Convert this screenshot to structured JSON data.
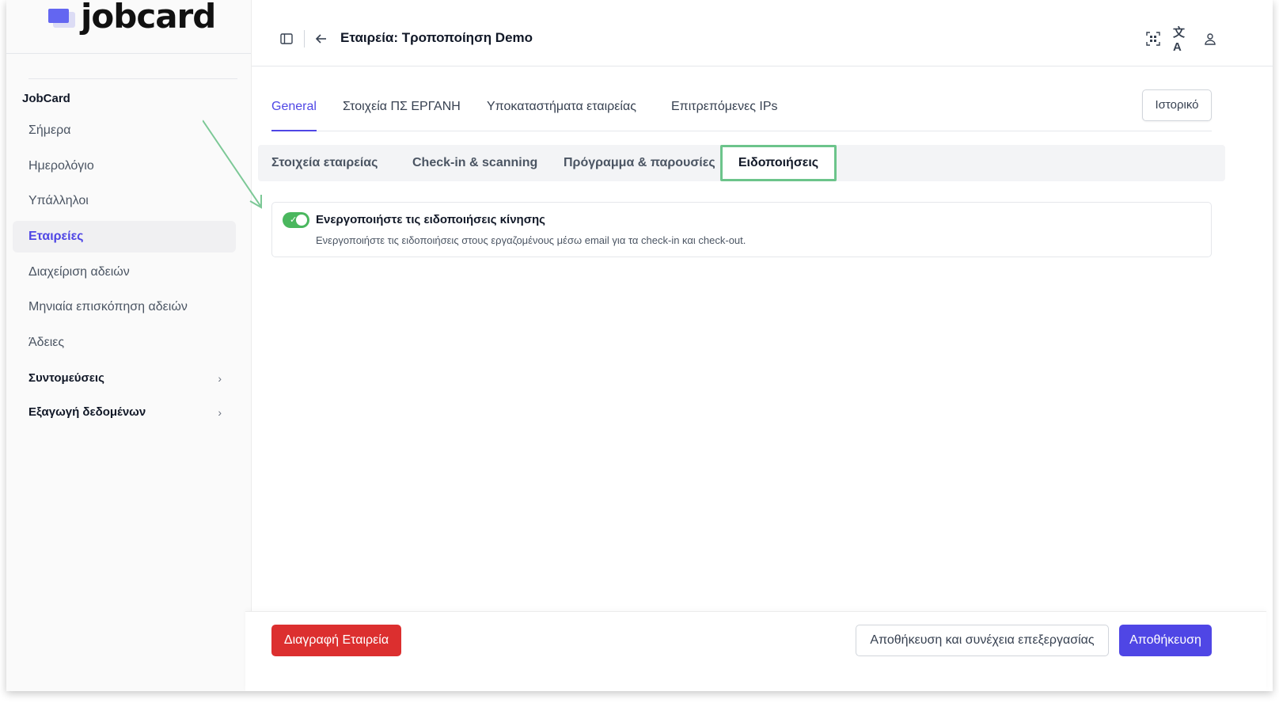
{
  "brand": {
    "name": "jobcard",
    "accent": "#4f46e5"
  },
  "sidebar": {
    "section_title": "JobCard",
    "items": [
      {
        "label": "Σήμερα",
        "active": false
      },
      {
        "label": "Ημερολόγιο",
        "active": false
      },
      {
        "label": "Υπάλληλοι",
        "active": false
      },
      {
        "label": "Εταιρείες",
        "active": true
      },
      {
        "label": "Διαχείριση αδειών",
        "active": false
      },
      {
        "label": "Μηνιαία επισκόπηση αδειών",
        "active": false
      },
      {
        "label": "Άδειες",
        "active": false
      }
    ],
    "groups": [
      {
        "label": "Συντομεύσεις",
        "icon": "chevron-right-icon"
      },
      {
        "label": "Εξαγωγή δεδομένων",
        "icon": "chevron-right-icon"
      }
    ]
  },
  "header": {
    "title": "Εταιρεία: Τροποποίηση Demo",
    "icons": [
      "sidebar-toggle-icon",
      "arrow-left-icon",
      "qr-scan-icon",
      "translate-icon",
      "user-icon"
    ]
  },
  "tabs": [
    {
      "label": "General",
      "active": true
    },
    {
      "label": "Στοιχεία ΠΣ ΕΡΓΑΝΗ",
      "active": false
    },
    {
      "label": "Υποκαταστήματα εταιρείας",
      "active": false
    },
    {
      "label": "Επιτρεπόμενες IPs",
      "active": false
    }
  ],
  "history_button": "Ιστορικό",
  "subtabs": [
    {
      "label": "Στοιχεία εταιρείας",
      "active": false
    },
    {
      "label": "Check-in & scanning",
      "active": false
    },
    {
      "label": "Πρόγραμμα & παρουσίες",
      "active": false
    },
    {
      "label": "Ειδοποιήσεις",
      "active": true
    }
  ],
  "notification": {
    "enabled": true,
    "title": "Ενεργοποιήστε τις ειδοποιήσεις κίνησης",
    "description": "Ενεργοποιήστε τις ειδοποιήσεις στους εργαζομένους μέσω email για τα check-in και check-out."
  },
  "footer": {
    "delete_label": "Διαγραφή Εταιρεία",
    "save_continue_label": "Αποθήκευση και συνέχεια επεξεργασίας",
    "save_label": "Αποθήκευση"
  },
  "colors": {
    "toggle_on": "#4ab75e",
    "danger": "#dc2f2f",
    "highlight": "#6cc48b"
  }
}
